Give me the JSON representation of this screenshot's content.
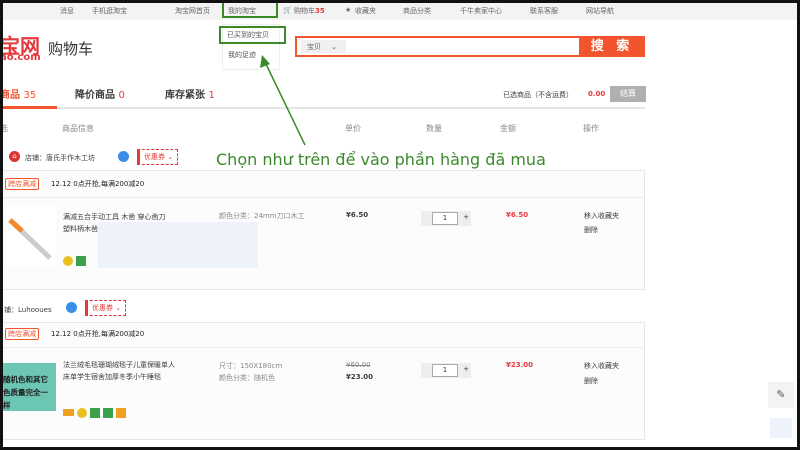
{
  "topbar": {
    "messages": "消息",
    "mobile": "手机逛淘宝",
    "home": "淘宝网首页",
    "my_taobao": "我的淘宝",
    "cart": "购物车",
    "cart_count": "35",
    "favorites": "收藏夹",
    "categories": "商品分类",
    "seller": "千牛卖家中心",
    "service": "联系客服",
    "sitenav": "网站导航"
  },
  "dropdown": {
    "bought": "已买到的宝贝",
    "footprint": "我的足迹"
  },
  "logo": {
    "text": "宝网",
    "sub": "ao.com"
  },
  "page_title": "购物车",
  "search": {
    "scope": "宝贝",
    "button": "搜 索",
    "value": ""
  },
  "tabs": [
    {
      "label": "商品",
      "count": "35"
    },
    {
      "label": "降价商品",
      "count": "0"
    },
    {
      "label": "库存紧张",
      "count": "1"
    }
  ],
  "summary": {
    "label": "已选商品（不含运费）",
    "total": "0.00",
    "checkout": "结算"
  },
  "columns": {
    "select": "选",
    "info": "商品信息",
    "price": "单价",
    "qty": "数量",
    "amount": "金额",
    "ops": "操作"
  },
  "annotation": "Chọn như trên để vào phần hàng đã mua",
  "shops": [
    {
      "name": "店铺：唐氏手作木工坊",
      "coupon": "优惠券",
      "promo_tag": "跨店满减",
      "promo": "12.12 0点开抢,每满200减20",
      "item": {
        "title": "满减五合手动工具 木凿 穿心凿刀 塑料柄木凿",
        "sku1": "颜色分类：24mm刀口木工",
        "sku2": "",
        "old_price": "",
        "price": "¥6.50",
        "qty": "1",
        "total": "¥6.50",
        "op1": "移入收藏夹",
        "op2": "删除"
      }
    },
    {
      "name": "铺：Luhooues",
      "coupon": "优惠券",
      "promo_tag": "跨店满减",
      "promo": "12.12 0点开抢,每满200减20",
      "item": {
        "title": "法兰绒毛毯珊瑚绒毯子儿童保暖单人床单学生宿舍加厚冬季小午睡毯",
        "sku1": "尺寸：150X180cm",
        "sku2": "颜色分类：随机色",
        "old_price": "¥60.00",
        "price": "¥23.00",
        "qty": "1",
        "total": "¥23.00",
        "op1": "移入收藏夹",
        "op2": "删除",
        "image_text": "随机色和其它色质量完全一样"
      }
    }
  ],
  "colors": {
    "accent": "#f2542d",
    "annotation": "#3a8a2a"
  }
}
